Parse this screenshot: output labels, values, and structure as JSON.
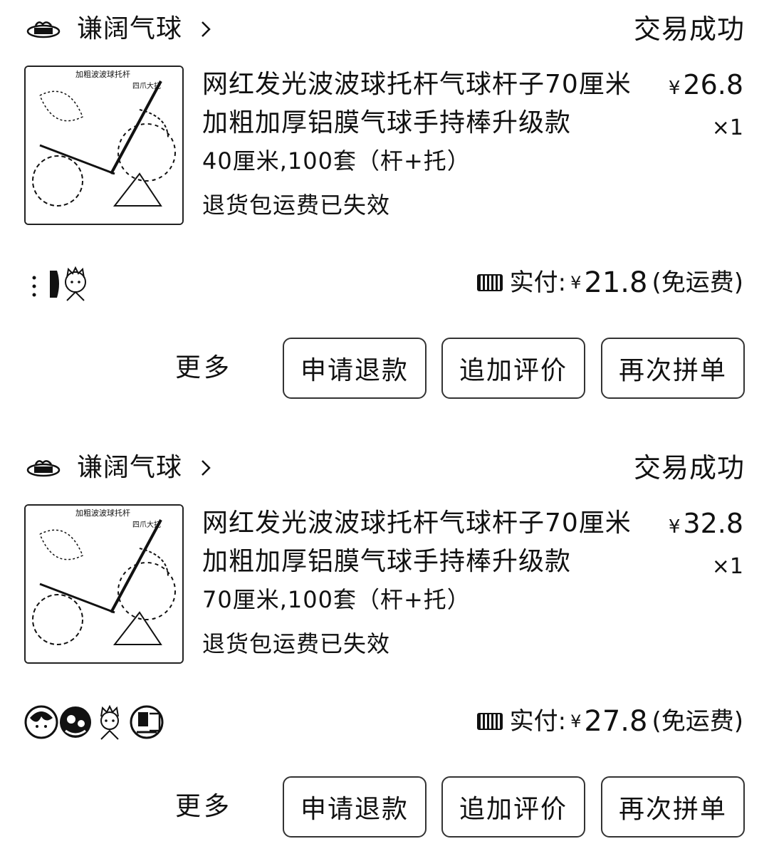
{
  "orders": [
    {
      "shop_name": "谦阔气球",
      "status": "交易成功",
      "title": "网红发光波波球托杆气球杆子70厘米加粗加厚铝膜气球手持棒升级款",
      "currency": "¥",
      "price": "26.8",
      "quantity": "×1",
      "spec": "40厘米,100套（杆+托）",
      "return_note": "退货包运费已失效",
      "paid_label": "实付:",
      "paid_amount": "21.8",
      "shipping_note": "(免运费)",
      "avatar_count": 1,
      "buttons": {
        "more": "更多",
        "refund": "申请退款",
        "review": "追加评价",
        "reorder": "再次拼单"
      }
    },
    {
      "shop_name": "谦阔气球",
      "status": "交易成功",
      "title": "网红发光波波球托杆气球杆子70厘米加粗加厚铝膜气球手持棒升级款",
      "currency": "¥",
      "price": "32.8",
      "quantity": "×1",
      "spec": "70厘米,100套（杆+托）",
      "return_note": "退货包运费已失效",
      "paid_label": "实付:",
      "paid_amount": "27.8",
      "shipping_note": "(免运费)",
      "avatar_count": 4,
      "buttons": {
        "more": "更多",
        "refund": "申请退款",
        "review": "追加评价",
        "reorder": "再次拼单"
      }
    }
  ]
}
